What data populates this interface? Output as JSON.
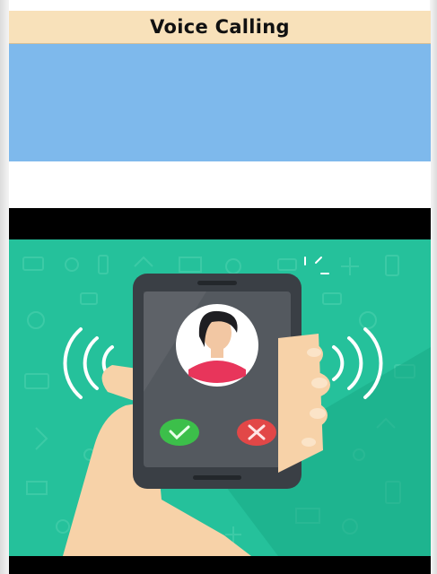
{
  "header": {
    "title": "Voice Calling"
  },
  "illustration": {
    "name": "incoming-call-illustration",
    "colors": {
      "background": "#25c19b",
      "pattern": "#4fd3b0",
      "phone": "#3a3f45",
      "screen": "#54595f",
      "accept": "#3cbf4a",
      "decline": "#e24747",
      "skin": "#f7d2a8",
      "banner": "#7eb9ec",
      "title_bar": "#f8e1ba"
    }
  }
}
